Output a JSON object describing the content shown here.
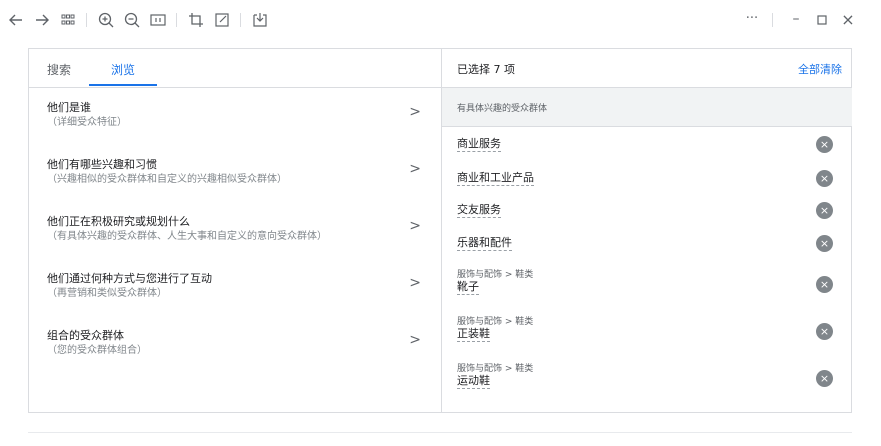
{
  "tabs": [
    {
      "label": "搜索"
    },
    {
      "label": "浏览"
    }
  ],
  "categories": [
    {
      "title": "他们是谁",
      "subtitle": "（详细受众特征）"
    },
    {
      "title": "他们有哪些兴趣和习惯",
      "subtitle": "（兴趣相似的受众群体和自定义的兴趣相似受众群体）"
    },
    {
      "title": "他们正在积极研究或规划什么",
      "subtitle": "（有具体兴趣的受众群体、人生大事和自定义的意向受众群体）"
    },
    {
      "title": "他们通过何种方式与您进行了互动",
      "subtitle": "（再营销和类似受众群体）"
    },
    {
      "title": "组合的受众群体",
      "subtitle": "（您的受众群体组合）"
    }
  ],
  "selected": {
    "count_label": "已选择 7 项",
    "clear_label": "全部清除",
    "group_label": "有具体兴趣的受众群体",
    "items": [
      {
        "path": "",
        "name": "商业服务"
      },
      {
        "path": "",
        "name": "商业和工业产品"
      },
      {
        "path": "",
        "name": "交友服务"
      },
      {
        "path": "",
        "name": "乐器和配件"
      },
      {
        "path": "服饰与配饰 > 鞋类",
        "name": "靴子"
      },
      {
        "path": "服饰与配饰 > 鞋类",
        "name": "正装鞋"
      },
      {
        "path": "服饰与配饰 > 鞋类",
        "name": "运动鞋"
      }
    ]
  },
  "icons": {
    "back": "arrow-left-icon",
    "forward": "arrow-right-icon",
    "grid": "grid-icon",
    "zoom_in": "zoom-in-icon",
    "zoom_out": "zoom-out-icon",
    "fit": "fit-page-icon",
    "crop": "crop-icon",
    "edit": "edit-icon",
    "save": "save-icon",
    "more": "more-icon",
    "minimize": "minimize-icon",
    "maximize": "maximize-icon",
    "close": "close-icon",
    "chevron": "chevron-right-icon",
    "remove": "remove-icon"
  },
  "glyphs": {
    "chevron": ">",
    "remove": "×",
    "more": "···",
    "minimize": "–",
    "close": "×"
  },
  "colors": {
    "accent": "#1a73e8",
    "remove_button": "#80868b"
  }
}
